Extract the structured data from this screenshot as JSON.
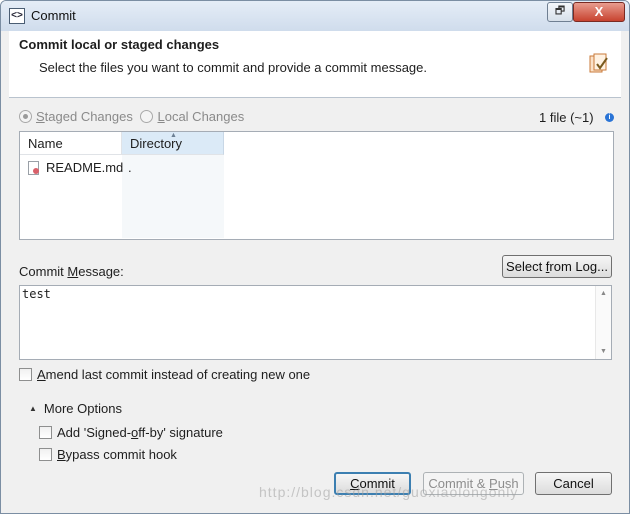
{
  "window": {
    "title": "Commit",
    "restore_button": "🗗",
    "close_button": "X"
  },
  "header": {
    "title": "Commit local or staged changes",
    "description": "Select the files you want to commit and provide a commit message."
  },
  "changes": {
    "staged_label": "Staged Changes",
    "staged_underline": "S",
    "staged_rest": "taged Changes",
    "local_label": "Local Changes",
    "local_underline": "L",
    "local_rest": "ocal Changes",
    "selected": "staged",
    "file_count": "1 file (~1)",
    "info_icon": "i"
  },
  "table": {
    "columns": [
      "Name",
      "Directory"
    ],
    "rows": [
      {
        "name": "README.md",
        "directory": "."
      }
    ]
  },
  "commit_message": {
    "label_prefix": "Commit ",
    "label_underline": "M",
    "label_suffix": "essage:",
    "select_log_prefix": "Select ",
    "select_log_underline": "f",
    "select_log_suffix": "rom Log...",
    "text": "test"
  },
  "options": {
    "amend_underline": "A",
    "amend_rest": "mend last commit instead of creating new one",
    "more_options": "More Options",
    "signed_off_prefix": "Add 'Signed-",
    "signed_off_underline": "o",
    "signed_off_suffix": "ff-by' signature",
    "bypass_underline": "B",
    "bypass_rest": "ypass commit hook"
  },
  "buttons": {
    "commit_underline": "C",
    "commit_rest": "ommit",
    "commit_push_prefix": "Commit & ",
    "commit_push_underline": "P",
    "commit_push_suffix": "ush",
    "cancel": "Cancel"
  },
  "watermark": "http://blog.csdn.net/guoxiaolongonly"
}
